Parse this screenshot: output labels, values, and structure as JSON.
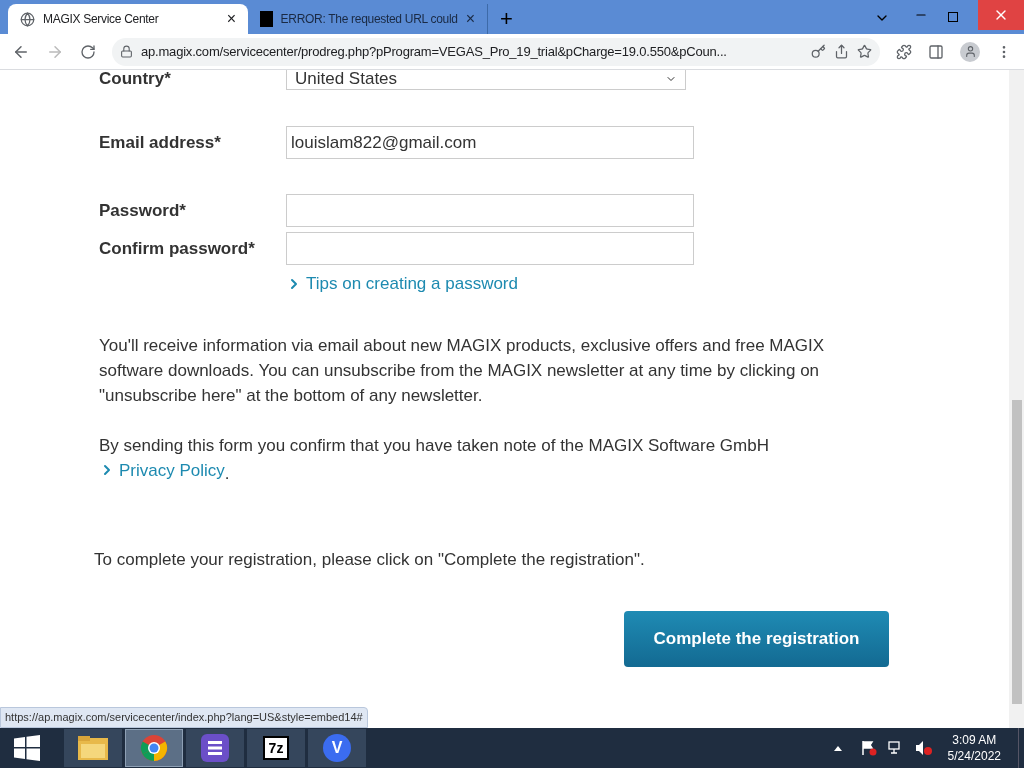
{
  "browser": {
    "tabs": [
      {
        "title": "MAGIX Service Center",
        "close": "×",
        "selected": true
      },
      {
        "title": "ERROR: The requested URL could",
        "close": "×",
        "selected": false
      }
    ],
    "new_tab": "+",
    "url": "ap.magix.com/servicecenter/prodreg.php?pProgram=VEGAS_Pro_19_trial&pCharge=19.0.550&pCoun..."
  },
  "form": {
    "fields": [
      {
        "label": "Country*",
        "kind": "select",
        "value": "United States"
      },
      {
        "label": "Email address*",
        "kind": "text",
        "value": "louislam822@gmail.com"
      },
      {
        "label": "Password*",
        "kind": "password"
      },
      {
        "label": "Confirm password*",
        "kind": "password"
      }
    ],
    "tips_link": "Tips on creating a password",
    "newsletter_text": "You'll receive information via email about new MAGIX products, exclusive offers and free MAGIX software downloads. You can unsubscribe from the MAGIX newsletter at any time by clicking on \"unsubscribe here\" at the bottom of any newsletter.",
    "privacy_text": "By sending this form you confirm that you have taken note of the MAGIX Software GmbH",
    "privacy_link": "Privacy Policy",
    "privacy_end": ".",
    "complete_note": "To complete your registration, please click on \"Complete the registration\".",
    "submit": "Complete the registration"
  },
  "status_url": "https://ap.magix.com/servicecenter/index.php?lang=US&style=embed14#",
  "taskbar": {
    "apps": [
      {
        "kind": "folder",
        "selected": false
      },
      {
        "kind": "chrome",
        "selected": true
      },
      {
        "kind": "bars",
        "selected": false
      },
      {
        "kind": "archive",
        "label": "7z",
        "selected": false
      },
      {
        "kind": "letter",
        "label": "V",
        "selected": false
      }
    ],
    "time": "3:09 AM",
    "date": "5/24/2022"
  }
}
